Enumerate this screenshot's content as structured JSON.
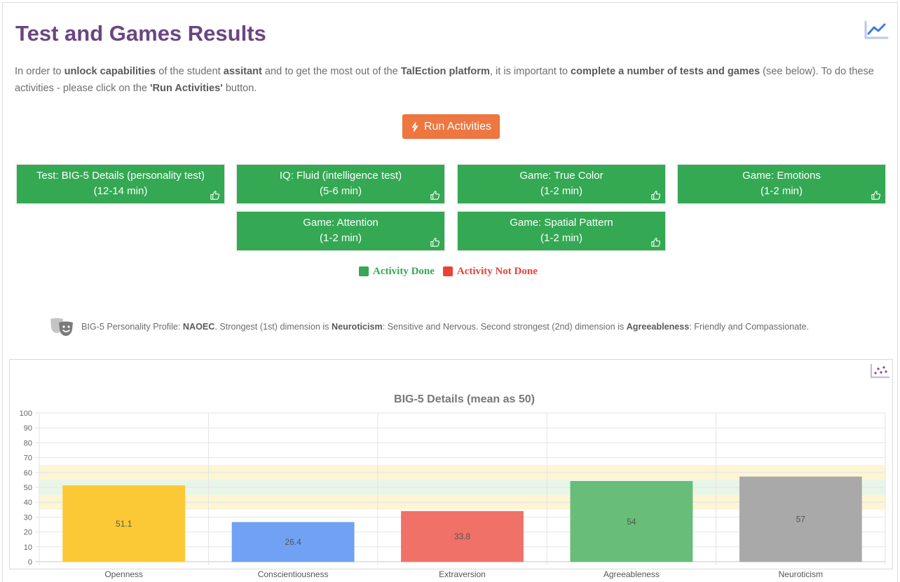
{
  "header": {
    "title": "Test and Games Results",
    "icon": "line-chart-icon",
    "accent_color": "#6b4583"
  },
  "intro": {
    "t1": "In order to ",
    "b1": "unlock capabilities",
    "t2": " of the student ",
    "b2": "assitant",
    "t3": " and to get the most out of the ",
    "b3": "TalEction platform",
    "t4": ", it is important to ",
    "b4": "complete a number of tests and games",
    "t5": " (see below). To do these activities - please click on the ",
    "b5": "'Run Activities'",
    "t6": " button."
  },
  "run_button": {
    "label": "Run Activities",
    "icon": "lightning-icon",
    "color": "#ee7741"
  },
  "activities": [
    {
      "name": "Test: BIG-5 Details (personality test)",
      "duration": "(12-14 min)",
      "status": "done"
    },
    {
      "name": "IQ: Fluid (intelligence test)",
      "duration": "(5-6 min)",
      "status": "done"
    },
    {
      "name": "Game: True Color",
      "duration": "(1-2 min)",
      "status": "done"
    },
    {
      "name": "Game: Emotions",
      "duration": "(1-2 min)",
      "status": "done"
    },
    {
      "name": "Game: Attention",
      "duration": "(1-2 min)",
      "status": "done"
    },
    {
      "name": "Game: Spatial Pattern",
      "duration": "(1-2 min)",
      "status": "done"
    }
  ],
  "legend": {
    "done": "Activity Done",
    "not_done": "Activity Not Done",
    "done_color": "#34a853",
    "not_done_color": "#ea4335"
  },
  "profile": {
    "icon": "theater-masks-icon",
    "t1": "BIG-5 Personality Profile: ",
    "code": "NAOEC",
    "t2": ". Strongest (1st) dimension is ",
    "first": "Neuroticism",
    "t3": ": Sensitive and Nervous. Second strongest (2nd) dimension is ",
    "second": "Agreeableness",
    "t4": ": Friendly and Compassionate."
  },
  "chart_icon": "scatter-plot-icon",
  "chart_data": {
    "type": "bar",
    "title": "BIG-5 Details (mean as 50)",
    "categories": [
      "Openness",
      "Conscientiousness",
      "Extraversion",
      "Agreeableness",
      "Neuroticism"
    ],
    "values": [
      51.1,
      26.4,
      33.8,
      54,
      57
    ],
    "colors": [
      "#fbc935",
      "#70a1f3",
      "#ef7168",
      "#68bd78",
      "#a9a9a9"
    ],
    "data_labels": [
      "51.1",
      "26.4",
      "33.8",
      "54",
      "57"
    ],
    "ylim": [
      0,
      100
    ],
    "yticks": [
      0,
      10,
      20,
      30,
      40,
      50,
      60,
      70,
      80,
      90,
      100
    ],
    "bands": [
      {
        "from": 35,
        "to": 65,
        "color": "#fdf5d3"
      },
      {
        "from": 45,
        "to": 55,
        "color": "#e8f6e9"
      }
    ],
    "grid": true,
    "legend": "none"
  }
}
